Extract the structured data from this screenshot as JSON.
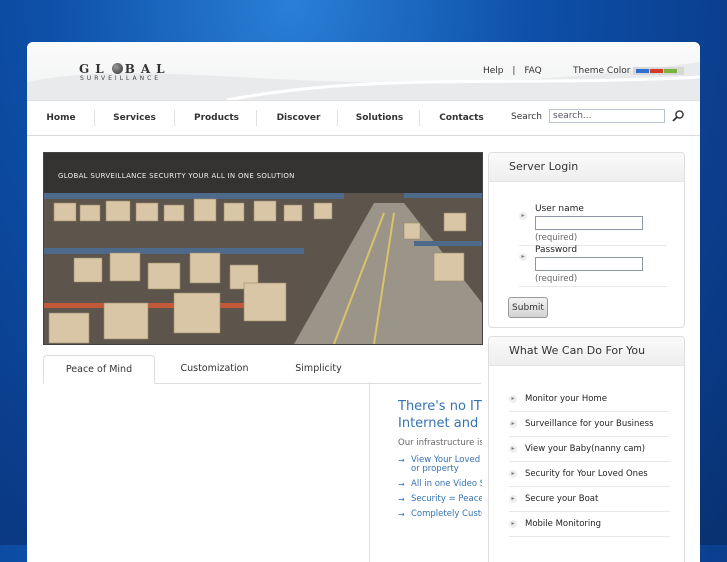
{
  "logo": {
    "word_left": "GL",
    "word_right": "BAL",
    "tagline": "SURVEILLANCE"
  },
  "toplinks": {
    "help": "Help",
    "sep": "|",
    "faq": "FAQ"
  },
  "theme": {
    "label": "Theme Color",
    "colors": [
      "#2e6fd0",
      "#d43a2a",
      "#7ab33a"
    ]
  },
  "nav": {
    "items": [
      "Home",
      "Services",
      "Products",
      "Discover",
      "Solutions",
      "Contacts"
    ]
  },
  "search": {
    "label": "Search",
    "placeholder": "search..."
  },
  "hero": {
    "caption": "GLOBAL SURVEILLANCE SECURITY YOUR ALL IN ONE SOLUTION"
  },
  "tabs": [
    "Peace of Mind",
    "Customization",
    "Simplicity"
  ],
  "content": {
    "heading_line1": "There's no IT",
    "heading_line2": "Internet and b",
    "intro": "Our infrastructure is s",
    "links": [
      {
        "line1": "View Your Loved",
        "line2": "or property"
      },
      {
        "line1": "All in one Video S",
        "line2": ""
      },
      {
        "line1": "Security = Peace",
        "line2": ""
      },
      {
        "line1": "Completely Custo",
        "line2": ""
      }
    ]
  },
  "login": {
    "title": "Server Login",
    "username_label": "User name",
    "password_label": "Password",
    "required": "(required)",
    "submit": "Submit"
  },
  "services": {
    "title": "What We Can Do For You",
    "items": [
      "Monitor your Home",
      "Surveillance for your Business",
      "View your Baby(nanny cam)",
      "Security for Your Loved Ones",
      "Secure your Boat",
      "Mobile Monitoring"
    ]
  }
}
